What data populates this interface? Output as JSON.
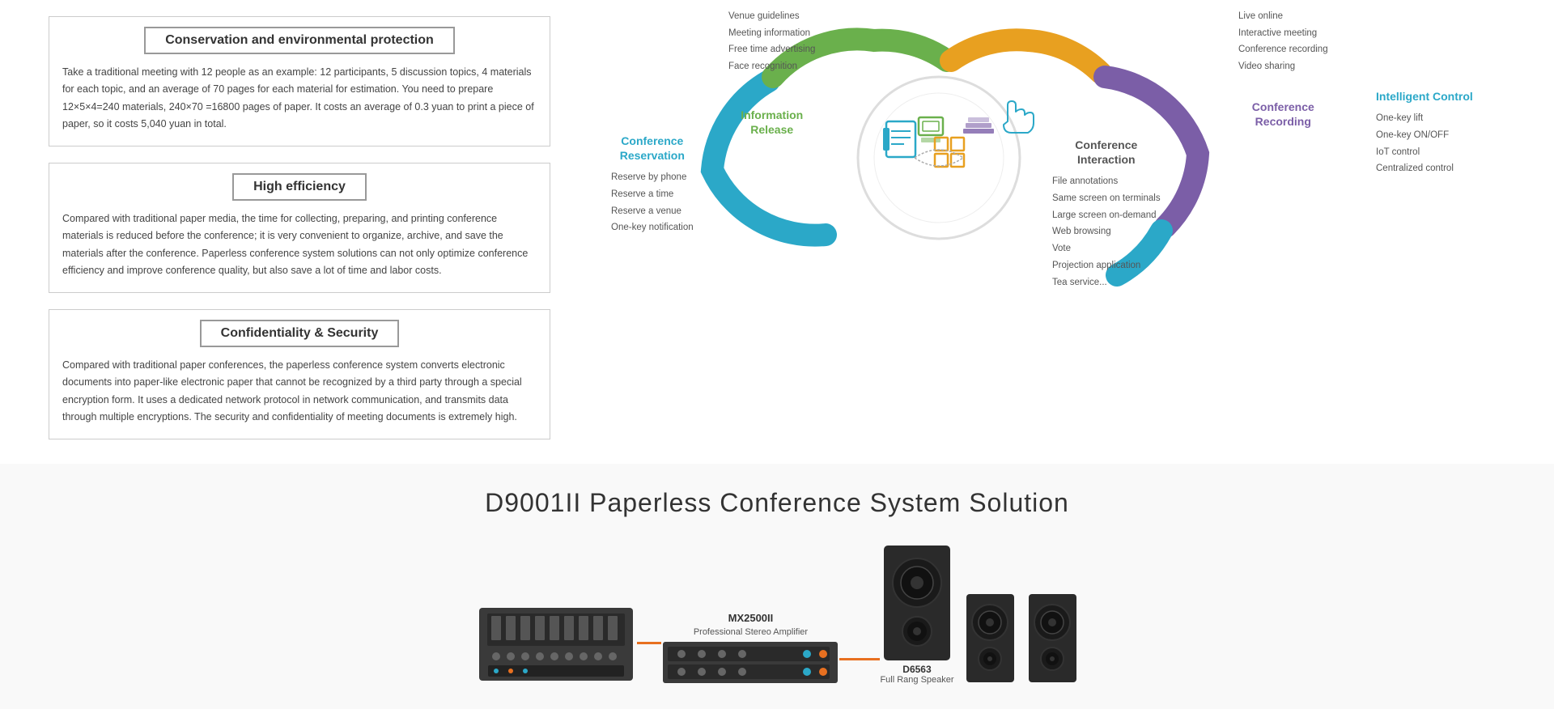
{
  "features": [
    {
      "id": "conservation",
      "title": "Conservation and environmental protection",
      "body": "Take a traditional meeting with 12 people as an example: 12 participants, 5 discussion topics, 4 materials for each topic, and an average of 70 pages for each material for estimation. You need to prepare 12×5×4=240 materials, 240×70 =16800 pages of paper. It costs an average of 0.3 yuan to print a piece of paper, so it costs 5,040 yuan in total."
    },
    {
      "id": "high-efficiency",
      "title": "High efficiency",
      "body": "Compared with traditional paper media, the time for collecting, preparing, and printing conference materials is reduced before the conference; it is very convenient to organize, archive, and save the materials after the conference. Paperless conference system solutions can not only optimize conference efficiency and improve conference quality, but also save a lot of time and labor costs."
    },
    {
      "id": "confidentiality",
      "title": "Confidentiality & Security",
      "body": "Compared with traditional paper conferences, the paperless conference system converts electronic documents into paper-like electronic paper that cannot be recognized by a third party through a special encryption form. It uses a dedicated network protocol in network communication, and transmits data through multiple encryptions. The security and confidentiality of meeting documents is extremely high."
    }
  ],
  "diagram": {
    "sections": {
      "conference_reservation": {
        "title": "Conference\nReservation",
        "color": "#2ba8c8",
        "items": [
          "Reserve by phone",
          "Reserve a time",
          "Reserve a venue",
          "One-key notification"
        ]
      },
      "information_release": {
        "title": "Information\nRelease",
        "color": "#6ab04c",
        "items": [
          "Venue guidelines",
          "Meeting information",
          "Free time advertising",
          "Face recognition"
        ]
      },
      "conference_interaction": {
        "title": "Conference\nInteraction",
        "color": "#e8a020",
        "items": [
          "File annotations",
          "Same screen on terminals",
          "Large screen on-demand",
          "Web browsing",
          "Vote",
          "Projection application",
          "Tea service..."
        ]
      },
      "conference_recording": {
        "title": "Conference\nRecording",
        "color": "#7b5ea7",
        "items": [
          "Live online",
          "Interactive meeting",
          "Conference recording",
          "Video sharing"
        ]
      },
      "intelligent_control": {
        "title": "Intelligent Control",
        "color": "#2ba8c8",
        "items": [
          "One-key lift",
          "One-key ON/OFF",
          "IoT control",
          "Centralized control"
        ]
      }
    }
  },
  "bottom": {
    "title": "D9001II Paperless Conference System Solution",
    "equipment": [
      {
        "id": "mixer",
        "name": "MX2500II",
        "description": "Professional Stereo Amplifier"
      },
      {
        "id": "amplifier",
        "name": "MX2500II",
        "description": "Professional Stereo Amplifier"
      },
      {
        "id": "speaker-large",
        "name": "D6563",
        "description": "Full Rang Speaker"
      }
    ]
  }
}
